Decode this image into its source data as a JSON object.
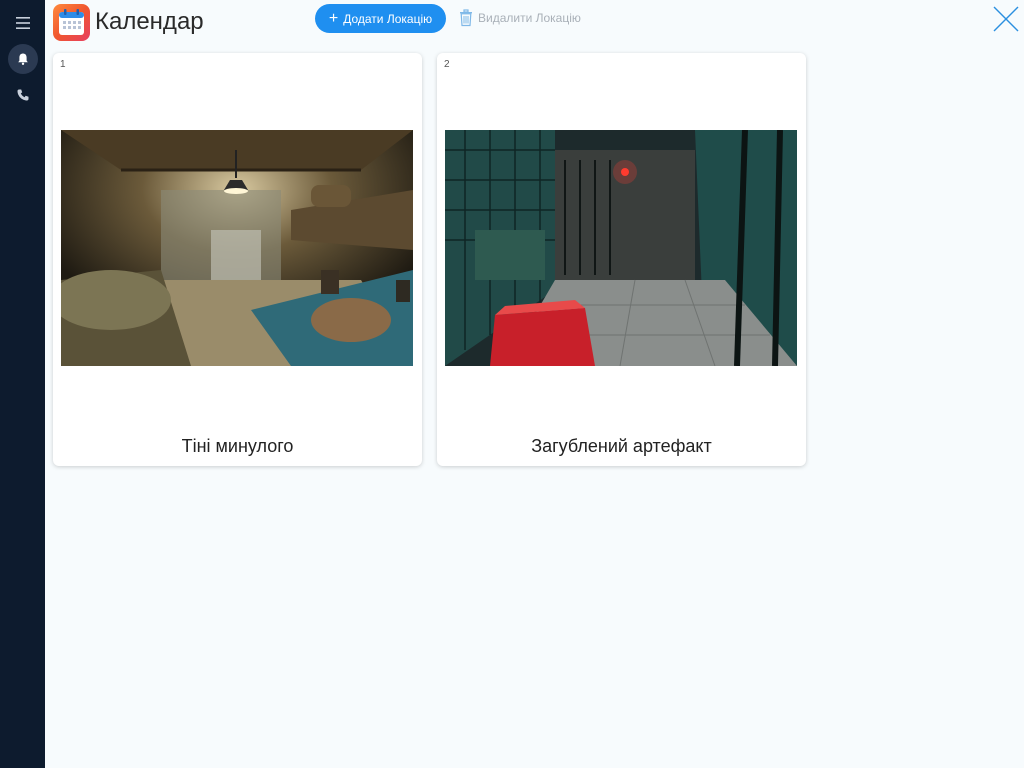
{
  "header": {
    "title": "Календар",
    "add_location_label": "Додати Локацію",
    "delete_location_label": "Видалити Локацію"
  },
  "sidebar": {
    "icons": [
      "menu-icon",
      "bell-icon",
      "phone-icon"
    ]
  },
  "locations": [
    {
      "number": "1",
      "name": "Тіні минулого"
    },
    {
      "number": "2",
      "name": "Загублений артефакт"
    }
  ],
  "colors": {
    "sidebar": "#0d1b2e",
    "accent": "#1f8ff0",
    "background": "#f7fbfd",
    "disabled": "#a9b0b8"
  }
}
